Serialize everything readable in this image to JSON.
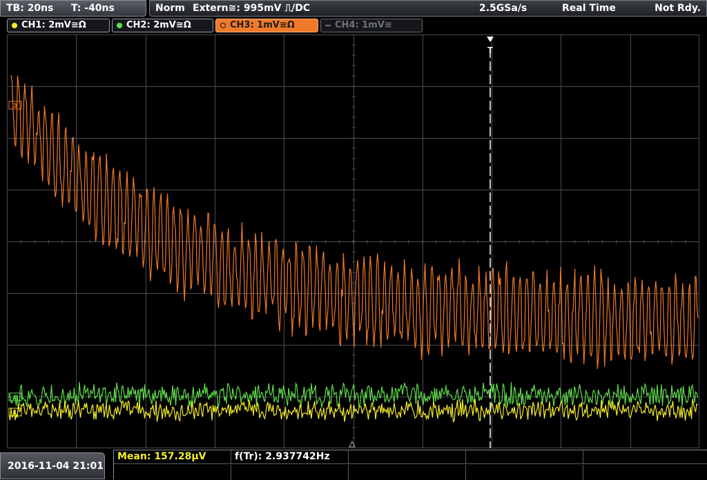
{
  "topbar": {
    "timebase": "TB: 20ns",
    "trigger_time": "T: -40ns",
    "mode": "Norm",
    "trigger_source": "Extern≅: 995mV ⎍/DC",
    "sample_rate": "2.5GSa/s",
    "acquisition": "Real Time",
    "status": "Not Rdy."
  },
  "channels": [
    {
      "label": "CH1: 2mV≅Ω",
      "color": "#f5ee2a"
    },
    {
      "label": "CH2: 2mV≅Ω",
      "color": "#5fe04a"
    },
    {
      "label": "CH3: 1mV≅Ω",
      "color": "#f07a2a"
    },
    {
      "label": "CH4: 1mV≅",
      "color": "#6f737a"
    }
  ],
  "markers": {
    "ch1": "1",
    "ch2": "2",
    "ch3": "3",
    "trigger": "T"
  },
  "footer": {
    "datetime": "2016-11-04 21:01",
    "mean_label": "Mean: 157.28µV",
    "freq_label": "f(Tr): 2.937742Hz"
  },
  "colors": {
    "ch1": "#f5ee2a",
    "ch2": "#5fe04a",
    "ch3": "#f07a2a",
    "grid": "#4a4d52",
    "trigger_line": "#ffffff",
    "mean_text": "#f5ee2a"
  }
}
